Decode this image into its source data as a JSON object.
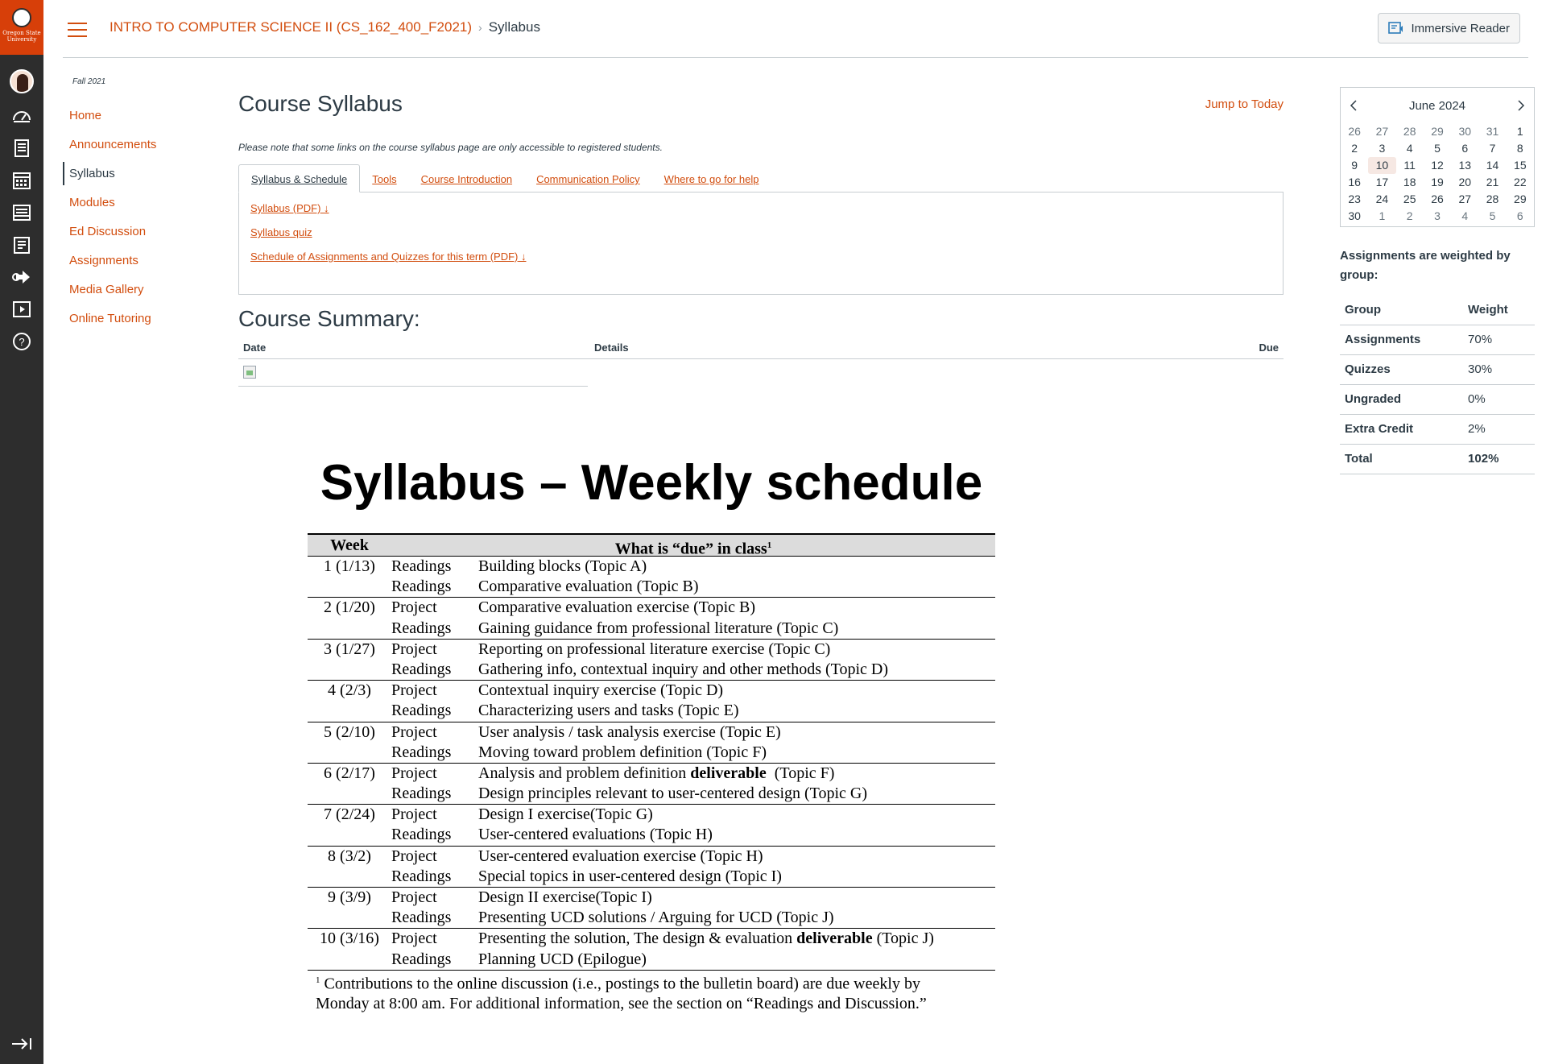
{
  "branding": {
    "university_line1": "Oregon State",
    "university_line2": "University"
  },
  "global_nav": {
    "icons": [
      "account-avatar",
      "dashboard-icon",
      "courses-icon",
      "calendar-icon",
      "inbox-icon",
      "history-icon",
      "commons-icon",
      "studio-icon",
      "help-icon",
      "collapse-nav-icon"
    ]
  },
  "header": {
    "course_link": "INTRO TO COMPUTER SCIENCE II (CS_162_400_F2021)",
    "current_page": "Syllabus",
    "immersive_reader": "Immersive Reader"
  },
  "course_nav": {
    "term": "Fall 2021",
    "items": [
      {
        "label": "Home"
      },
      {
        "label": "Announcements"
      },
      {
        "label": "Syllabus"
      },
      {
        "label": "Modules"
      },
      {
        "label": "Ed Discussion"
      },
      {
        "label": "Assignments"
      },
      {
        "label": "Media Gallery"
      },
      {
        "label": "Online Tutoring"
      }
    ],
    "active": "Syllabus"
  },
  "main": {
    "title": "Course Syllabus",
    "jump_today": "Jump to Today",
    "note": "Please note that some links on the course syllabus page are only accessible to registered students.",
    "tabs": [
      "Syllabus & Schedule",
      "Tools",
      "Course Introduction",
      "Communication Policy",
      "Where to go for help"
    ],
    "panel_links": [
      "Syllabus (PDF)",
      "Syllabus quiz",
      "Schedule of Assignments and Quizzes for this term (PDF)"
    ],
    "summary_title": "Course Summary:",
    "summary_cols": {
      "date": "Date",
      "details": "Details",
      "due": "Due"
    }
  },
  "schedule": {
    "title": "Syllabus – Weekly schedule",
    "col_week": "Week",
    "col_what": "What is “due” in class",
    "col_what_sup": "1",
    "weeks": [
      {
        "week": "1 (1/13)",
        "lines": [
          {
            "type": "Readings",
            "desc": "Building blocks (Topic A)"
          },
          {
            "type": "Readings",
            "desc": "Comparative evaluation (Topic B)"
          }
        ]
      },
      {
        "week": "2 (1/20)",
        "lines": [
          {
            "type": "Project",
            "desc": "Comparative evaluation exercise (Topic B)"
          },
          {
            "type": "Readings",
            "desc": "Gaining guidance from professional literature (Topic C)"
          }
        ]
      },
      {
        "week": "3 (1/27)",
        "lines": [
          {
            "type": "Project",
            "desc": "Reporting on professional literature exercise (Topic C)"
          },
          {
            "type": "Readings",
            "desc": "Gathering info, contextual inquiry and other methods (Topic D)"
          }
        ]
      },
      {
        "week": "4 (2/3)",
        "lines": [
          {
            "type": "Project",
            "desc": "Contextual inquiry exercise (Topic D)"
          },
          {
            "type": "Readings",
            "desc": "Characterizing users and tasks (Topic E)"
          }
        ]
      },
      {
        "week": "5 (2/10)",
        "lines": [
          {
            "type": "Project",
            "desc": "User analysis / task analysis exercise (Topic E)"
          },
          {
            "type": "Readings",
            "desc": "Moving toward problem definition (Topic F)"
          }
        ]
      },
      {
        "week": "6 (2/17)",
        "lines": [
          {
            "type": "Project",
            "desc_pre": "Analysis and problem definition ",
            "desc_bold": "deliverable",
            "desc_post": "  (Topic F)"
          },
          {
            "type": "Readings",
            "desc": "Design principles relevant to user-centered design (Topic G)"
          }
        ]
      },
      {
        "week": "7 (2/24)",
        "lines": [
          {
            "type": "Project",
            "desc": "Design I exercise(Topic G)"
          },
          {
            "type": "Readings",
            "desc": "User-centered evaluations (Topic H)"
          }
        ]
      },
      {
        "week": "8 (3/2)",
        "lines": [
          {
            "type": "Project",
            "desc": "User-centered evaluation exercise (Topic H)"
          },
          {
            "type": "Readings",
            "desc": "Special topics in user-centered design (Topic I)"
          }
        ]
      },
      {
        "week": "9 (3/9)",
        "lines": [
          {
            "type": "Project",
            "desc": "Design II exercise(Topic I)"
          },
          {
            "type": "Readings",
            "desc": "Presenting UCD solutions / Arguing for UCD (Topic J)"
          }
        ]
      },
      {
        "week": "10 (3/16)",
        "lines": [
          {
            "type": "Project",
            "desc_pre": "Presenting the solution, The design & evaluation ",
            "desc_bold": "deliverable",
            "desc_post": " (Topic J)"
          },
          {
            "type": "Readings",
            "desc": "Planning UCD (Epilogue)"
          }
        ]
      }
    ],
    "footnote_sup": "1",
    "footnote_line1": " Contributions to the online discussion (i.e., postings to the bulletin board) are due weekly by",
    "footnote_line2": "Monday at 8:00 am.  For additional information, see the section on “Readings and Discussion.”"
  },
  "calendar": {
    "month": "June 2024",
    "weeks": [
      [
        {
          "d": "26",
          "m": true
        },
        {
          "d": "27",
          "m": true
        },
        {
          "d": "28",
          "m": true
        },
        {
          "d": "29",
          "m": true
        },
        {
          "d": "30",
          "m": true
        },
        {
          "d": "31",
          "m": true
        },
        {
          "d": "1"
        }
      ],
      [
        {
          "d": "2"
        },
        {
          "d": "3"
        },
        {
          "d": "4"
        },
        {
          "d": "5"
        },
        {
          "d": "6"
        },
        {
          "d": "7"
        },
        {
          "d": "8"
        }
      ],
      [
        {
          "d": "9"
        },
        {
          "d": "10",
          "today": true
        },
        {
          "d": "11"
        },
        {
          "d": "12"
        },
        {
          "d": "13"
        },
        {
          "d": "14"
        },
        {
          "d": "15"
        }
      ],
      [
        {
          "d": "16"
        },
        {
          "d": "17"
        },
        {
          "d": "18"
        },
        {
          "d": "19"
        },
        {
          "d": "20"
        },
        {
          "d": "21"
        },
        {
          "d": "22"
        }
      ],
      [
        {
          "d": "23"
        },
        {
          "d": "24"
        },
        {
          "d": "25"
        },
        {
          "d": "26"
        },
        {
          "d": "27"
        },
        {
          "d": "28"
        },
        {
          "d": "29"
        }
      ],
      [
        {
          "d": "30"
        },
        {
          "d": "1",
          "m": true
        },
        {
          "d": "2",
          "m": true
        },
        {
          "d": "3",
          "m": true
        },
        {
          "d": "4",
          "m": true
        },
        {
          "d": "5",
          "m": true
        },
        {
          "d": "6",
          "m": true
        }
      ]
    ]
  },
  "weights": {
    "title": "Assignments are weighted by group:",
    "col_group": "Group",
    "col_weight": "Weight",
    "rows": [
      {
        "group": "Assignments",
        "weight": "70%"
      },
      {
        "group": "Quizzes",
        "weight": "30%"
      },
      {
        "group": "Ungraded",
        "weight": "0%"
      },
      {
        "group": "Extra Credit",
        "weight": "2%"
      }
    ],
    "total_label": "Total",
    "total_value": "102%"
  },
  "colors": {
    "brand": "#d73f09",
    "link": "#d24d0e",
    "nav_bg": "#2d2d2d",
    "text": "#2d3b45"
  }
}
